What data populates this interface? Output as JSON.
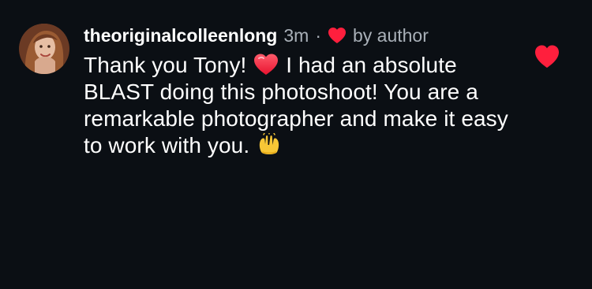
{
  "comment": {
    "username": "theoriginalcolleenlong",
    "time_ago": "3m",
    "separator": "·",
    "author_note": "by author",
    "text_segments": [
      "Thank you Tony! ",
      " I had an absolute BLAST doing this photoshoot!  You are a remarkable photographer and make it easy to work with you. "
    ],
    "heart_color": "#ff1f3d",
    "text_color": "#ffffff",
    "meta_color": "#a9b0b8",
    "background": "#0b0f14",
    "icons": {
      "author_like": "red-heart-icon",
      "inline_emoji_1": "red-heart-emoji",
      "inline_emoji_2": "raising-hands-emoji",
      "like_button": "red-heart-icon"
    }
  }
}
